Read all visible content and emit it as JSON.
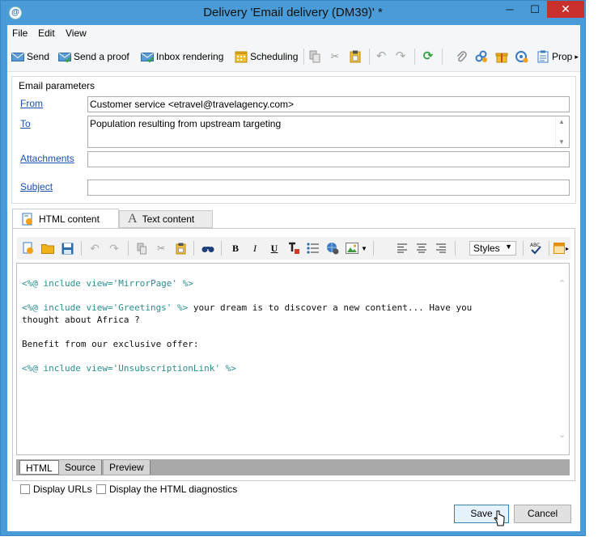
{
  "window": {
    "title": "Delivery 'Email delivery (DM39)' *",
    "controls": {
      "minimize": "─",
      "maximize": "☐",
      "close": "✕"
    }
  },
  "menu": {
    "file": "File",
    "edit": "Edit",
    "view": "View"
  },
  "toolbar": {
    "send": "Send",
    "send_proof": "Send a proof",
    "inbox_rendering": "Inbox rendering",
    "scheduling": "Scheduling",
    "properties": "Prop",
    "more": "▸"
  },
  "email_params": {
    "group_title": "Email parameters",
    "from_label": "From",
    "from_value": "Customer service <etravel@travelagency.com>",
    "to_label": "To",
    "to_value": "Population resulting from upstream targeting",
    "attachments_label": "Attachments",
    "attachments_value": "",
    "subject_label": "Subject",
    "subject_value": ""
  },
  "content_tabs": {
    "html": "HTML content",
    "text": "Text content",
    "text_icon": "A"
  },
  "editor": {
    "bold": "B",
    "italic": "I",
    "underline": "U",
    "styles_label": "Styles",
    "code": [
      {
        "dir": "<%@ include view='MirrorPage' %>",
        "text": ""
      },
      {
        "dir": "",
        "text": ""
      },
      {
        "dir": "<%@ include view='Greetings' %>",
        "text": " your dream is to discover a new contient... Have you"
      },
      {
        "dir": "",
        "text": "thought about Africa ?"
      },
      {
        "dir": "",
        "text": ""
      },
      {
        "dir": "",
        "text": "Benefit from our exclusive offer:"
      },
      {
        "dir": "",
        "text": ""
      },
      {
        "dir": "<%@ include view='UnsubscriptionLink' %>",
        "text": ""
      }
    ]
  },
  "mode_tabs": {
    "html": "HTML",
    "source": "Source",
    "preview": "Preview"
  },
  "options": {
    "display_urls": "Display URLs",
    "display_diagnostics": "Display the HTML diagnostics"
  },
  "buttons": {
    "save": "Save",
    "cancel": "Cancel"
  },
  "colors": {
    "title_bar": "#4a9cd8",
    "close_button": "#c9302c",
    "link": "#1a4fb5",
    "directive": "#2a8f8f"
  }
}
